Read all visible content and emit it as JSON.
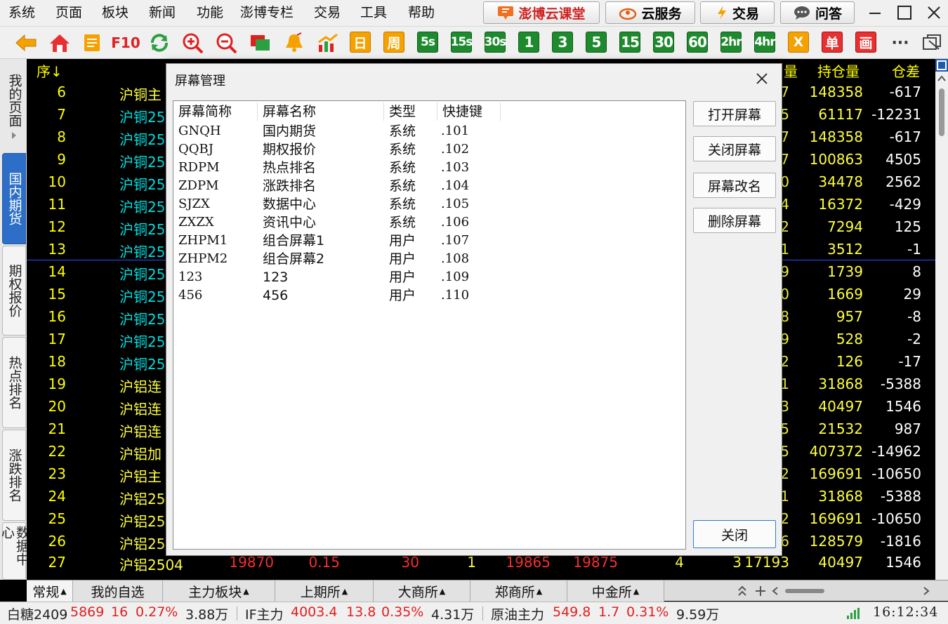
{
  "menu": [
    "系统",
    "页面",
    "板块",
    "新闻",
    "功能",
    "澎博专栏",
    "交易",
    "工具",
    "帮助"
  ],
  "top_buttons": {
    "class_label": "澎博云课堂",
    "cloud_label": "云服务",
    "trade_label": "交易",
    "qa_label": "问答"
  },
  "toolbar": {
    "f10": "F10",
    "day": "日",
    "week": "周",
    "periods": [
      "5s",
      "15s",
      "30s",
      "1",
      "3",
      "5",
      "15",
      "30",
      "60",
      "2hr",
      "4hr"
    ],
    "x": "X",
    "single": "单",
    "draw": "画",
    "more": "···"
  },
  "side_tabs": [
    "我的页面",
    "国内期货",
    "期权报价",
    "热点排名",
    "涨跌排名",
    "数据中心"
  ],
  "grid": {
    "headers": {
      "seq": "序↓",
      "hold_suffix": "量",
      "hold": "持仓量",
      "diff": "仓差"
    },
    "rows": [
      {
        "n": "6",
        "name": "沪铜主",
        "right": "7",
        "hold": "148358",
        "diff": "-617"
      },
      {
        "n": "7",
        "name": "沪铜25",
        "right": "5",
        "hold": "61117",
        "diff": "-12231"
      },
      {
        "n": "8",
        "name": "沪铜25",
        "right": "7",
        "hold": "148358",
        "diff": "-617"
      },
      {
        "n": "9",
        "name": "沪铜25",
        "right": "7",
        "hold": "100863",
        "diff": "4505"
      },
      {
        "n": "10",
        "name": "沪铜25",
        "right": "0",
        "hold": "34478",
        "diff": "2562"
      },
      {
        "n": "11",
        "name": "沪铜25",
        "right": "4",
        "hold": "16372",
        "diff": "-429"
      },
      {
        "n": "12",
        "name": "沪铜25",
        "right": "2",
        "hold": "7294",
        "diff": "125"
      },
      {
        "n": "13",
        "name": "沪铜25",
        "right": "1",
        "hold": "3512",
        "diff": "-1"
      },
      {
        "n": "14",
        "name": "沪铜25",
        "right": "9",
        "hold": "1739",
        "diff": "8"
      },
      {
        "n": "15",
        "name": "沪铜25",
        "right": "0",
        "hold": "1669",
        "diff": "29"
      },
      {
        "n": "16",
        "name": "沪铜25",
        "right": "8",
        "hold": "957",
        "diff": "-8"
      },
      {
        "n": "17",
        "name": "沪铜25",
        "right": "9",
        "hold": "528",
        "diff": "-2"
      },
      {
        "n": "18",
        "name": "沪铜25",
        "right": "2",
        "hold": "126",
        "diff": "-17"
      },
      {
        "n": "19",
        "name": "沪铝连",
        "right": "1",
        "hold": "31868",
        "diff": "-5388"
      },
      {
        "n": "20",
        "name": "沪铝连",
        "right": "3",
        "hold": "40497",
        "diff": "1546"
      },
      {
        "n": "21",
        "name": "沪铝连",
        "right": "5",
        "hold": "21532",
        "diff": "987"
      },
      {
        "n": "22",
        "name": "沪铝加",
        "right": "5",
        "hold": "407372",
        "diff": "-14962"
      },
      {
        "n": "23",
        "name": "沪铝主",
        "right": "2",
        "hold": "169691",
        "diff": "-10650"
      },
      {
        "n": "24",
        "name": "沪铝25",
        "right": "1",
        "hold": "31868",
        "diff": "-5388"
      },
      {
        "n": "25",
        "name": "沪铝25",
        "right": "2",
        "hold": "169691",
        "diff": "-10650"
      },
      {
        "n": "26",
        "name": "沪铝25",
        "right": "6",
        "hold": "128579",
        "diff": "-1816"
      }
    ],
    "last_row": {
      "n": "27",
      "name": "沪铝2504",
      "price": "19870",
      "pct": "0.15",
      "vol": "30",
      "cur": "1",
      "bid": "19865",
      "ask": "19875",
      "bidv": "4",
      "askv": "3",
      "total": "17193",
      "hold": "40497",
      "diff": "1546"
    }
  },
  "bottom_tabs": [
    "常规",
    "我的自选",
    "主力板块",
    "上期所",
    "大商所",
    "郑商所",
    "中金所"
  ],
  "ticker": [
    {
      "name": "白糖2409",
      "price": "5869",
      "chg": "16",
      "pct": "0.27%",
      "vol": "3.88万"
    },
    {
      "name": "IF主力",
      "price": "4003.4",
      "chg": "13.8",
      "pct": "0.35%",
      "vol": "4.31万"
    },
    {
      "name": "原油主力",
      "price": "549.8",
      "chg": "1.7",
      "pct": "0.31%",
      "vol": "9.59万"
    }
  ],
  "clock": "16:12:34",
  "dialog": {
    "title": "屏幕管理",
    "columns": [
      "屏幕简称",
      "屏幕名称",
      "类型",
      "快捷键"
    ],
    "items": [
      {
        "abbr": "GNQH",
        "name": "国内期货",
        "type": "系统",
        "key": ".101"
      },
      {
        "abbr": "QQBJ",
        "name": "期权报价",
        "type": "系统",
        "key": ".102"
      },
      {
        "abbr": "RDPM",
        "name": "热点排名",
        "type": "系统",
        "key": ".103"
      },
      {
        "abbr": "ZDPM",
        "name": "涨跌排名",
        "type": "系统",
        "key": ".104"
      },
      {
        "abbr": "SJZX",
        "name": "数据中心",
        "type": "系统",
        "key": ".105"
      },
      {
        "abbr": "ZXZX",
        "name": "资讯中心",
        "type": "系统",
        "key": ".106"
      },
      {
        "abbr": "ZHPM1",
        "name": "组合屏幕1",
        "type": "用户",
        "key": ".107"
      },
      {
        "abbr": "ZHPM2",
        "name": "组合屏幕2",
        "type": "用户",
        "key": ".108"
      },
      {
        "abbr": "123",
        "name": "123",
        "type": "用户",
        "key": ".109"
      },
      {
        "abbr": "456",
        "name": "456",
        "type": "用户",
        "key": ".110"
      }
    ],
    "buttons": {
      "open": "打开屏幕",
      "close_screen": "关闭屏幕",
      "rename": "屏幕改名",
      "delete": "删除屏幕",
      "close": "关闭"
    }
  }
}
